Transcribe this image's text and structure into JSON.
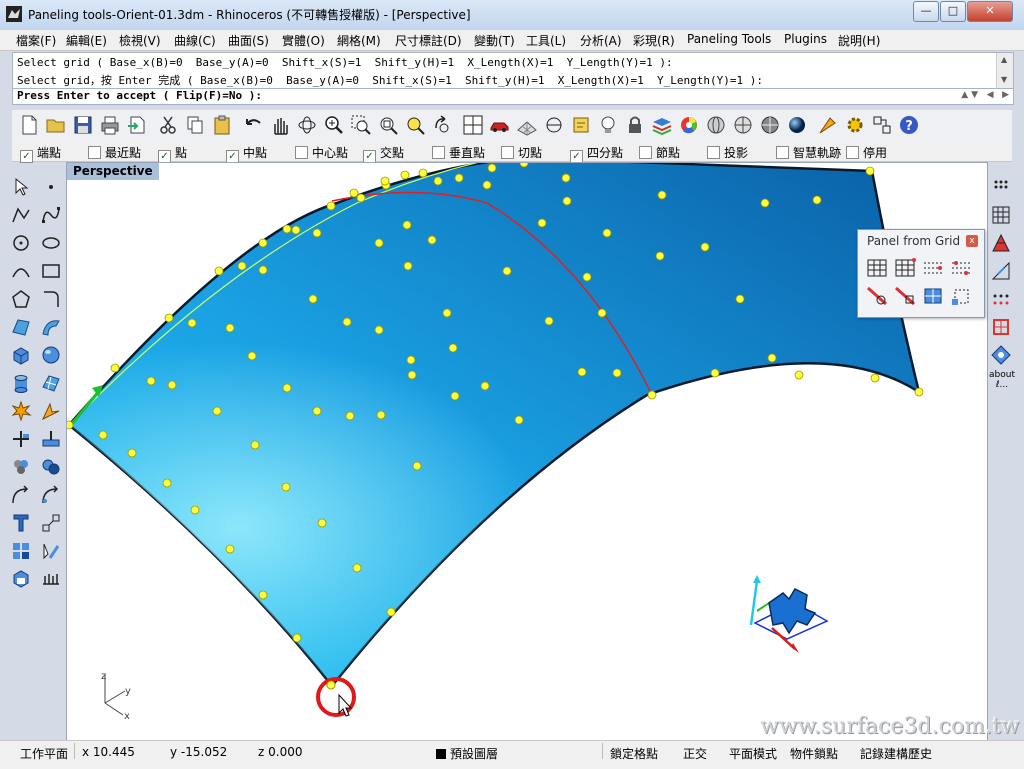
{
  "window": {
    "title": "Paneling tools-Orient-01.3dm - Rhinoceros (不可轉售授權版) - [Perspective]",
    "minimize": "—",
    "maximize": "□",
    "close": "✕"
  },
  "menu": [
    "檔案(F)",
    "編輯(E)",
    "檢視(V)",
    "曲線(C)",
    "曲面(S)",
    "實體(O)",
    "網格(M)",
    "尺寸標註(D)",
    "變動(T)",
    "工具(L)",
    "分析(A)",
    "彩現(R)",
    "Paneling Tools",
    "Plugins",
    "說明(H)"
  ],
  "command_history": [
    "Select grid ( Base_x(B)=0  Base_y(A)=0  Shift_x(S)=1  Shift_y(H)=1  X_Length(X)=1  Y_Length(Y)=1 ):",
    "Select grid，按 Enter 完成 ( Base_x(B)=0  Base_y(A)=0  Shift_x(S)=1  Shift_y(H)=1  X_Length(X)=1  Y_Length(Y)=1 ):"
  ],
  "command_prompt": "Press Enter to accept ( Flip(F)=No ):",
  "toolbar_icons": [
    "new-file-icon",
    "open-folder-icon",
    "save-icon",
    "print-icon",
    "import-icon",
    "cut-icon",
    "copy-icon",
    "paste-icon",
    "undo-icon",
    "pan-hand-icon",
    "rotate-view-icon",
    "zoom-icon",
    "zoom-window-icon",
    "zoom-extents-icon",
    "zoom-selected-icon",
    "undo-view-icon",
    "four-viewports-icon",
    "car-render-icon",
    "grid-icon",
    "cplane-icon",
    "object-properties-icon",
    "lightbulb-icon",
    "lock-icon",
    "layer-icon",
    "color-wheel-icon",
    "shade-icon",
    "ghosted-icon",
    "render-sphere-icon",
    "render-preview-icon",
    "options-gear-icon",
    "paneling-tools-icon",
    "help-icon"
  ],
  "osnaps": [
    {
      "label": "端點",
      "checked": true
    },
    {
      "label": "最近點",
      "checked": false
    },
    {
      "label": "點",
      "checked": true
    },
    {
      "label": "中點",
      "checked": true
    },
    {
      "label": "中心點",
      "checked": false
    },
    {
      "label": "交點",
      "checked": true
    },
    {
      "label": "垂直點",
      "checked": false
    },
    {
      "label": "切點",
      "checked": false
    },
    {
      "label": "四分點",
      "checked": true
    },
    {
      "label": "節點",
      "checked": false
    },
    {
      "label": "投影",
      "checked": false
    },
    {
      "label": "智慧軌跡",
      "checked": false
    },
    {
      "label": "停用",
      "checked": false
    }
  ],
  "left_tools": [
    "select-arrow-icon",
    "point-icon",
    "polyline-icon",
    "curve-icon",
    "circle-icon",
    "ellipse-icon",
    "arc-icon",
    "rectangle-icon",
    "polygon-icon",
    "fillet-icon",
    "surface-icon",
    "sweep-icon",
    "box-icon",
    "sphere-icon",
    "cylinder-icon",
    "mesh-icon",
    "explode-icon",
    "transform-icon",
    "trim-icon",
    "boolean-icon",
    "group-icon",
    "boolean-union-icon",
    "dimension-icon",
    "scale-icon",
    "text-icon",
    "array-icon",
    "block-icon",
    "paste-attrs-icon",
    "render-icon",
    "history-icon"
  ],
  "right_tools": [
    "paneling-grid-1-icon",
    "paneling-grid-2-icon",
    "paneling-triangle-icon",
    "paneling-shift-icon",
    "paneling-points-icon",
    "paneling-frame-icon",
    "paneling-flower-icon"
  ],
  "right_about_label": "about ℓ...",
  "viewport": {
    "label": "Perspective",
    "axis_x": "x",
    "axis_y": "y",
    "axis_z": "z"
  },
  "panel": {
    "title": "Panel from Grid",
    "close": "x",
    "icons": [
      "panel-grid-icon",
      "panel-grid-offset-icon",
      "panel-dashed-grid-icon",
      "panel-dashed-grid-alt-icon",
      "panel-red-grid-icon",
      "panel-red-grid-offset-icon",
      "panel-blue-grid-icon",
      "panel-frame-icon"
    ]
  },
  "watermark": "www.surface3d.com.tw",
  "status": {
    "cplane": "工作平面",
    "x": "x 10.445",
    "y": "y -15.052",
    "z": "z 0.000",
    "layer": "預設圖層",
    "grid_snap": "鎖定格點",
    "ortho": "正交",
    "planar": "平面模式",
    "osnap": "物件鎖點",
    "history": "記錄建構歷史"
  },
  "colors": {
    "surface": "#1aa6e8",
    "surface_dark": "#0a6fb0",
    "point": "#ffff3c",
    "isocurve_red": "#e02020",
    "isocurve_yellow": "#c8ff60",
    "cursor_ring": "#e01818"
  }
}
